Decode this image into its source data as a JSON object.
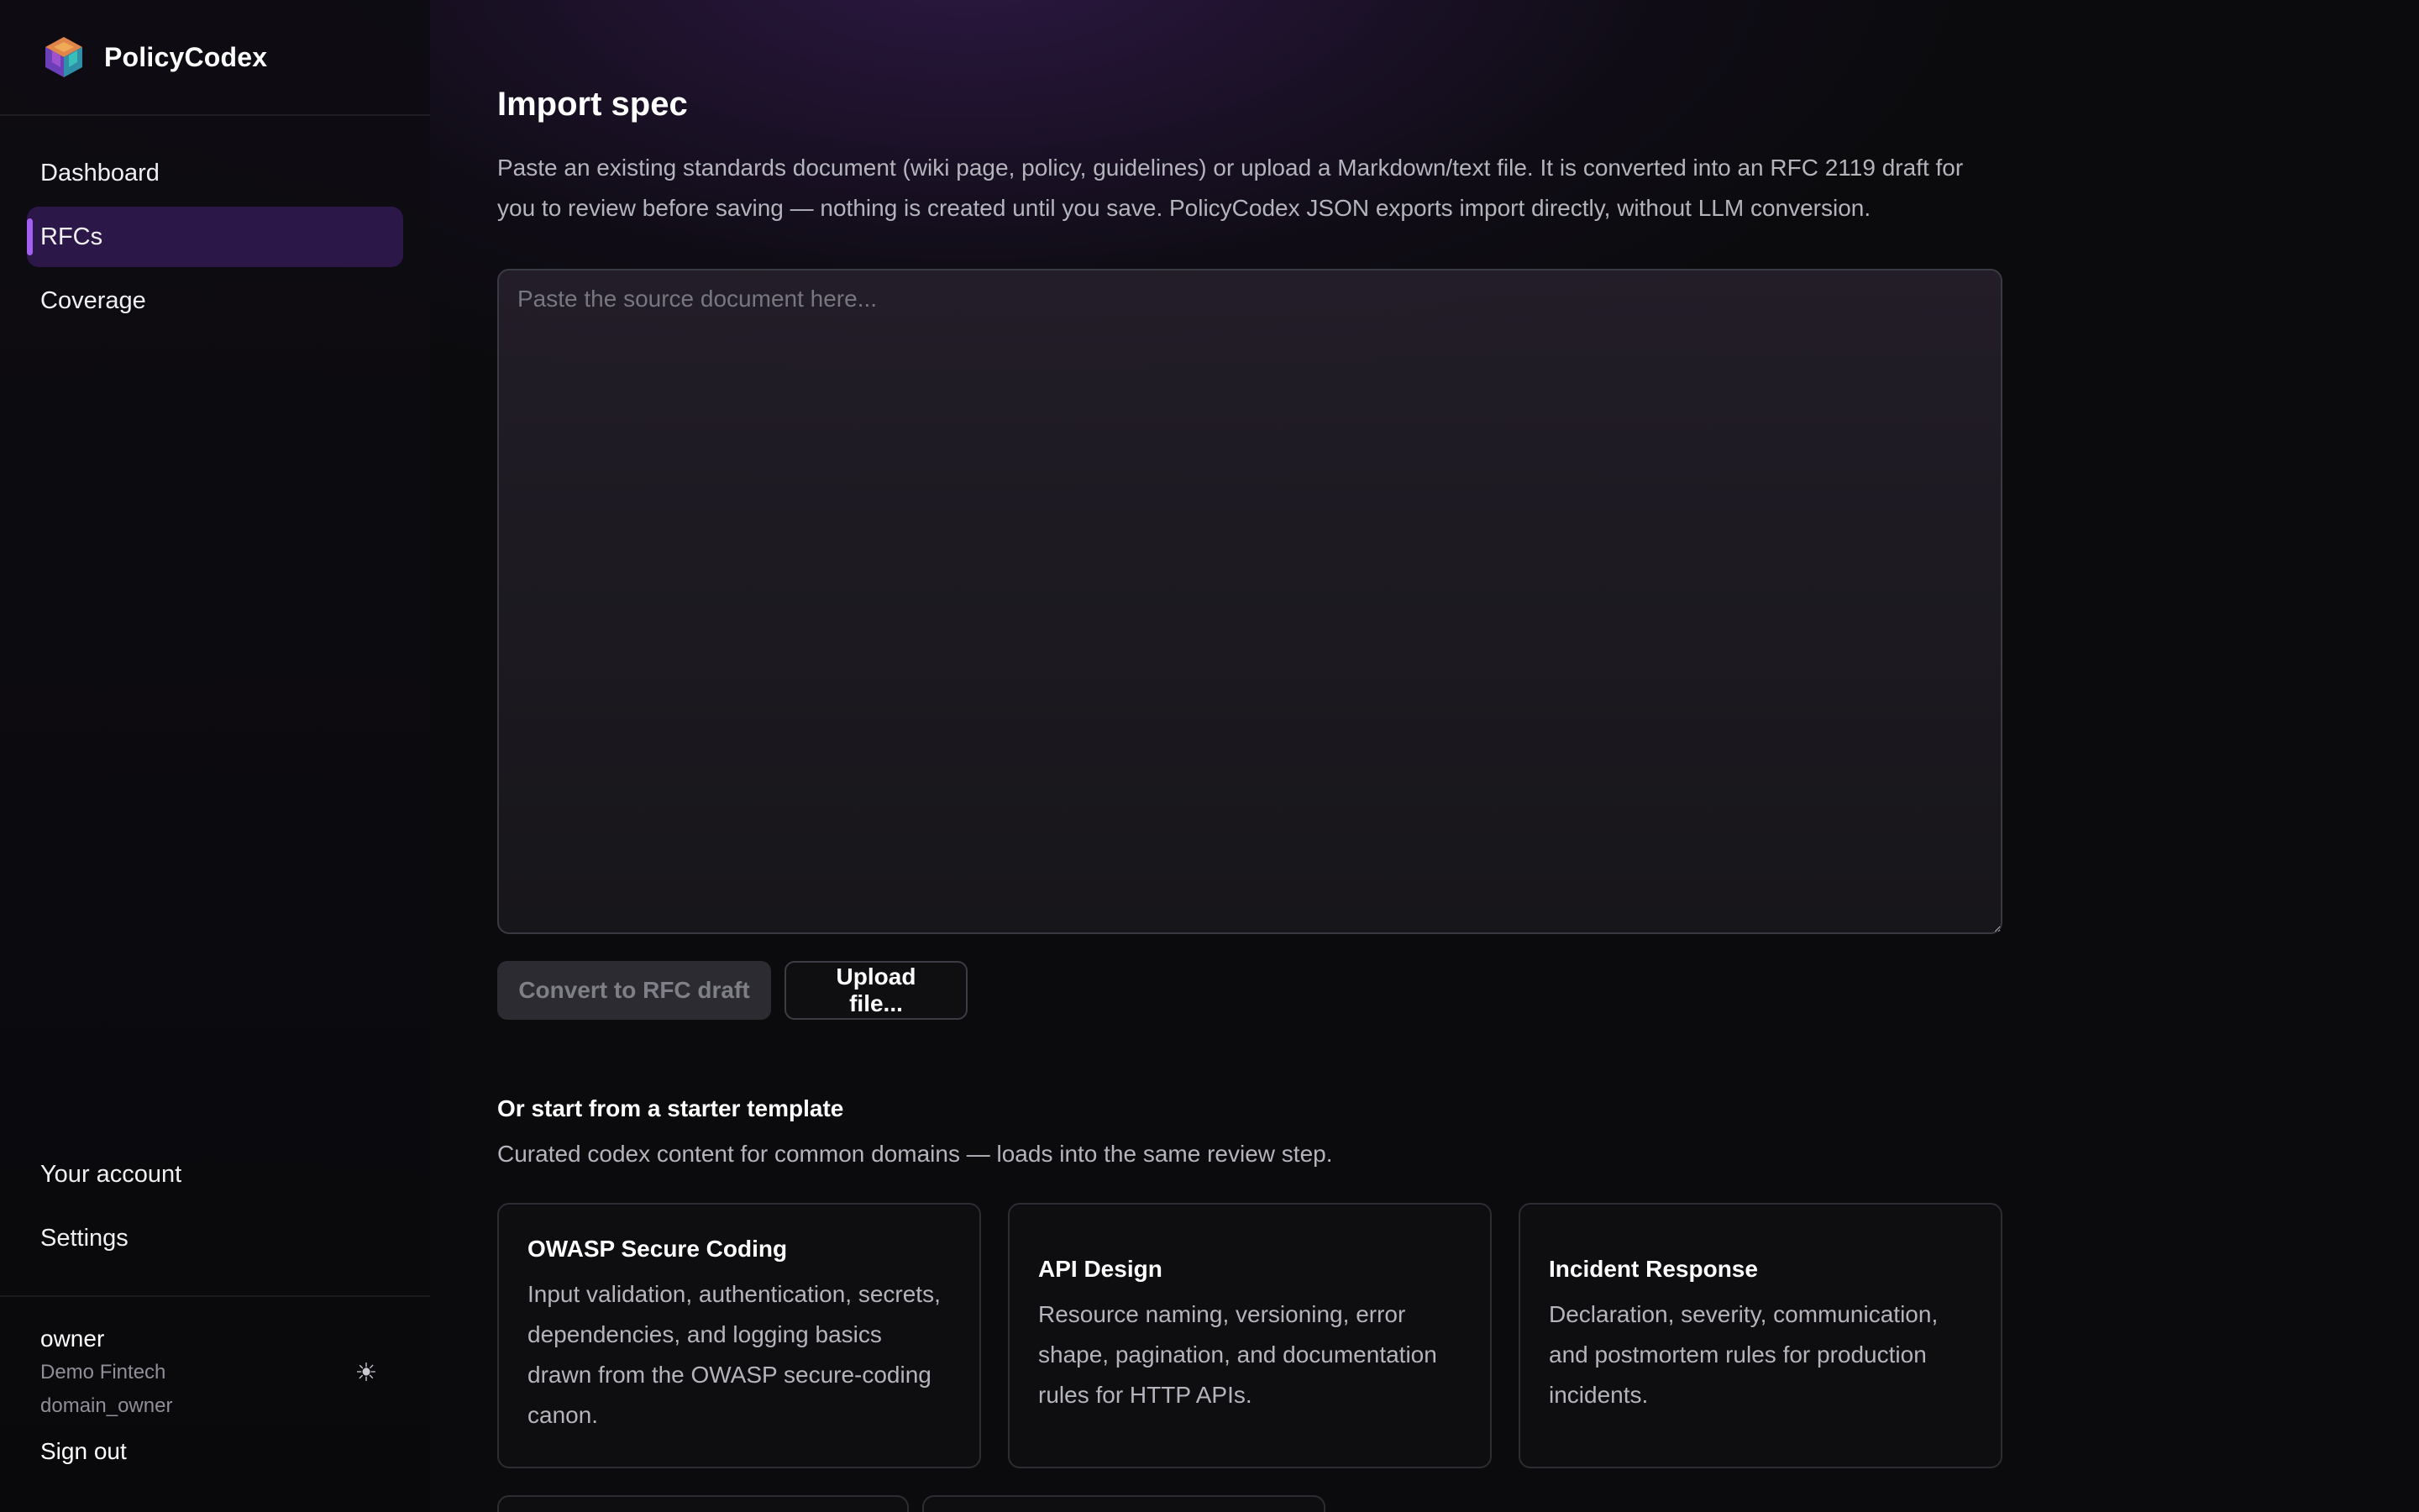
{
  "brand": {
    "name": "PolicyCodex",
    "logo_icon": "codex-cube-logo"
  },
  "sidebar": {
    "nav": [
      {
        "label": "Dashboard",
        "active": false
      },
      {
        "label": "RFCs",
        "active": true
      },
      {
        "label": "Coverage",
        "active": false
      }
    ],
    "bottom_nav": [
      {
        "label": "Your account"
      },
      {
        "label": "Settings"
      }
    ],
    "user": {
      "name": "owner",
      "org": "Demo Fintech",
      "role": "domain_owner",
      "theme_icon": "sun-icon",
      "theme_glyph": "☀"
    },
    "sign_out_label": "Sign out"
  },
  "main": {
    "title": "Import spec",
    "description": "Paste an existing standards document (wiki page, policy, guidelines) or upload a Markdown/text file. It is converted into an RFC 2119 draft for you to review before saving — nothing is created until you save. PolicyCodex JSON exports import directly, without LLM conversion.",
    "source_input": {
      "value": "",
      "placeholder": "Paste the source document here..."
    },
    "convert_button": "Convert to RFC draft",
    "upload_button": "Upload file...",
    "templates": {
      "title": "Or start from a starter template",
      "description": "Curated codex content for common domains — loads into the same review step.",
      "cards": [
        {
          "title": "OWASP Secure Coding",
          "description": "Input validation, authentication, secrets, dependencies, and logging basics drawn from the OWASP secure-coding canon."
        },
        {
          "title": "API Design",
          "description": "Resource naming, versioning, error shape, pagination, and documentation rules for HTTP APIs."
        },
        {
          "title": "Incident Response",
          "description": "Declaration, severity, communication, and postmortem rules for production incidents."
        }
      ]
    }
  },
  "colors": {
    "accent": "#a160f0",
    "active_nav_bg": "#2b1748",
    "background": "#0b0b0e"
  }
}
